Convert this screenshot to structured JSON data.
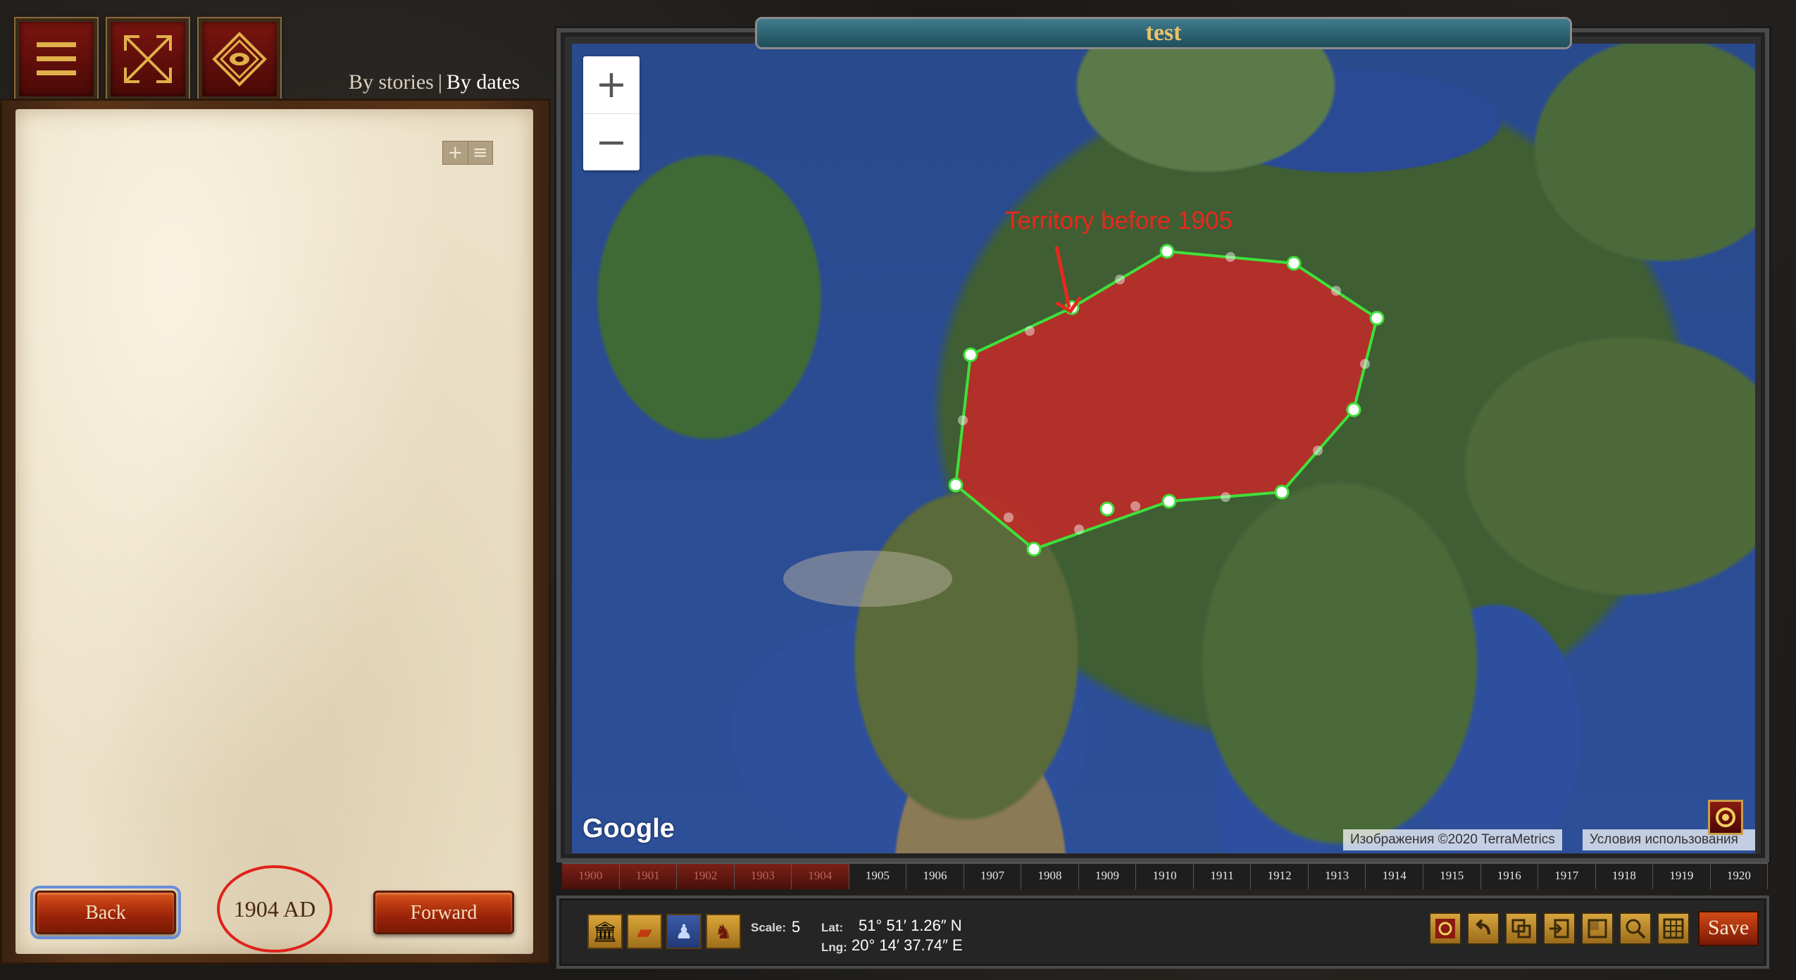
{
  "header": {
    "menu_icon": "hamburger-menu-icon",
    "fullscreen_icon": "fullscreen-arrows-icon",
    "diamond_icon": "diamond-target-icon",
    "view_toggle": {
      "by_stories": "By stories",
      "separator": "|",
      "by_dates": "By dates",
      "active": "By dates"
    }
  },
  "left_panel": {
    "add_icon_label": "+",
    "list_icon_label": "≡",
    "back_label": "Back",
    "forward_label": "Forward",
    "current_date": "1904 AD"
  },
  "map": {
    "title": "test",
    "zoom_in": "+",
    "zoom_out": "−",
    "annotation": "Territory before 1905",
    "polygon_color": "#c62828",
    "polygon_stroke": "#3fe03a",
    "logo": "Google",
    "attribution": "Изображения ©2020 TerraMetrics",
    "terms": "Условия использования"
  },
  "timeline": {
    "years": [
      "1900",
      "1901",
      "1902",
      "1903",
      "1904",
      "1905",
      "1906",
      "1907",
      "1908",
      "1909",
      "1910",
      "1911",
      "1912",
      "1913",
      "1914",
      "1915",
      "1916",
      "1917",
      "1918",
      "1919",
      "1920"
    ],
    "past_years": [
      "1900",
      "1901",
      "1902",
      "1903",
      "1904"
    ]
  },
  "toolbar": {
    "layer_icons": [
      "museum-icon",
      "map-icon",
      "person-icon",
      "horse-rider-icon"
    ],
    "scale_label": "Scale:",
    "scale_value": "5",
    "lat_label": "Lat:",
    "lat_value": "51° 51′ 1.26″ N",
    "lng_label": "Lng:",
    "lng_value": "20° 14′ 37.74″ E",
    "tool_icons": [
      "target-icon",
      "undo-icon",
      "copy-icon",
      "import-icon",
      "crop-icon",
      "search-icon",
      "grid-icon"
    ],
    "save_label": "Save"
  },
  "colors": {
    "accent_red": "#8a1a10",
    "button_orange": "#d24a14",
    "title_teal": "#2e6a7a",
    "title_text": "#e8c26a"
  }
}
